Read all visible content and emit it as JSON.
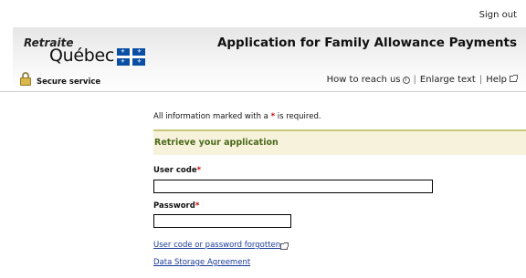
{
  "header": {
    "sign_out": "Sign out",
    "logo_line1": "Retraite",
    "logo_line2": "Québec",
    "app_title": "Application for Family Allowance Payments",
    "secure_service": "Secure service",
    "links": {
      "how_to_reach": "How to reach us",
      "enlarge_text": "Enlarge text",
      "help": "Help"
    }
  },
  "form": {
    "required_note_before": "All information marked with a",
    "required_star": "*",
    "required_note_after": "is required.",
    "section_title": "Retrieve your application",
    "user_code_label": "User code",
    "user_code_value": "",
    "password_label": "Password",
    "password_value": "",
    "forgot_link": "User code or password forgotten",
    "storage_link": "Data Storage Agreement"
  },
  "colors": {
    "section_bg": "#f7f2dc",
    "section_title": "#4a6a1a",
    "required_star": "#cc0000",
    "link": "#1a3a9a"
  }
}
